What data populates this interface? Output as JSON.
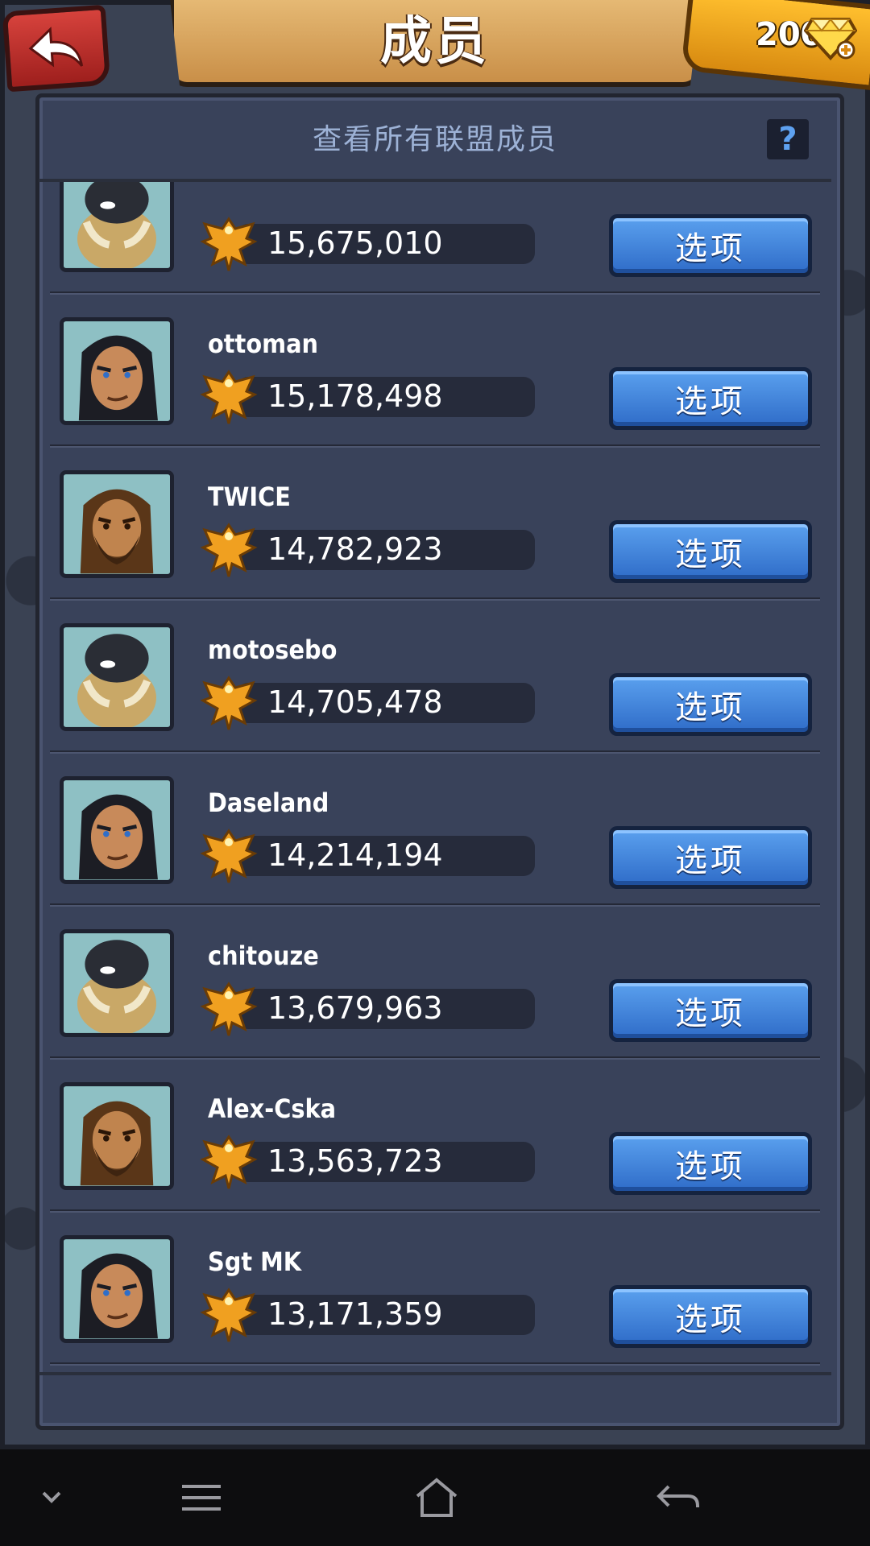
{
  "header": {
    "title": "成员",
    "gems": "200"
  },
  "subtitle": "查看所有联盟成员",
  "help_label": "?",
  "members": [
    {
      "name": "",
      "score": "15,675,010",
      "avatar": "rhino-warrior-icon",
      "option_label": "选项"
    },
    {
      "name": "ottoman",
      "score": "15,178,498",
      "avatar": "dark-hair-warrior-icon",
      "option_label": "选项"
    },
    {
      "name": "TWICE",
      "score": "14,782,923",
      "avatar": "bearded-warrior-icon",
      "option_label": "选项"
    },
    {
      "name": "motosebo",
      "score": "14,705,478",
      "avatar": "rhino-warrior-icon",
      "option_label": "选项"
    },
    {
      "name": "Daseland",
      "score": "14,214,194",
      "avatar": "dark-hair-warrior-icon",
      "option_label": "选项"
    },
    {
      "name": "chitouze",
      "score": "13,679,963",
      "avatar": "rhino-warrior-icon",
      "option_label": "选项"
    },
    {
      "name": "Alex-Cska",
      "score": "13,563,723",
      "avatar": "bearded-warrior-icon",
      "option_label": "选项"
    },
    {
      "name": "Sgt MK",
      "score": "13,171,359",
      "avatar": "dark-hair-warrior-icon",
      "option_label": "选项"
    }
  ],
  "colors": {
    "panel": "#39425a",
    "option_button": "#3f82dc",
    "title_banner": "#d9a45e",
    "gems_box": "#f2a81c",
    "back_button": "#c2302c"
  }
}
